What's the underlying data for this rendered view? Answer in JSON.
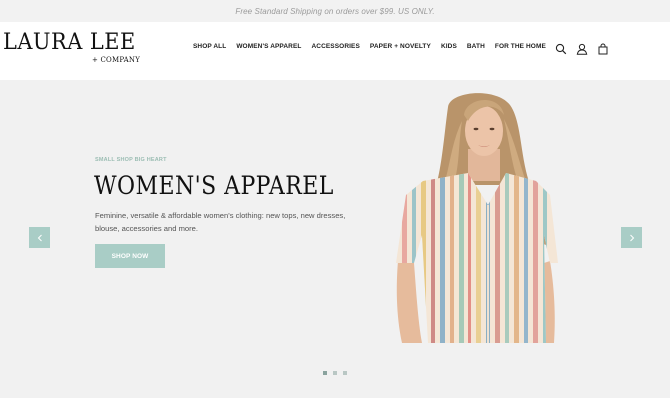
{
  "announcement": {
    "text": "Free Standard Shipping on orders over $99. US ONLY."
  },
  "brand": {
    "name": "LAURA LEE",
    "sub": "+ COMPANY"
  },
  "nav": {
    "items": [
      {
        "label": "SHOP ALL"
      },
      {
        "label": "WOMEN'S APPAREL"
      },
      {
        "label": "ACCESSORIES"
      },
      {
        "label": "PAPER + NOVELTY"
      },
      {
        "label": "KIDS"
      },
      {
        "label": "BATH"
      },
      {
        "label": "FOR THE HOME"
      }
    ]
  },
  "header_icons": [
    "search-icon",
    "account-icon",
    "cart-icon"
  ],
  "hero": {
    "eyebrow": "SMALL SHOP BIG HEART",
    "headline": "WOMEN'S APPAREL",
    "description": "Feminine, versatile & affordable women's clothing: new tops, new dresses, blouse, accessories and more.",
    "cta_label": "SHOP NOW",
    "slide_count": 3,
    "active_slide": 1
  },
  "colors": {
    "accent": "#a9cdc6",
    "eyebrow": "#9bbdb3",
    "hero_bg": "#f1f1f1",
    "announcement_bg": "#f2f2f2"
  }
}
